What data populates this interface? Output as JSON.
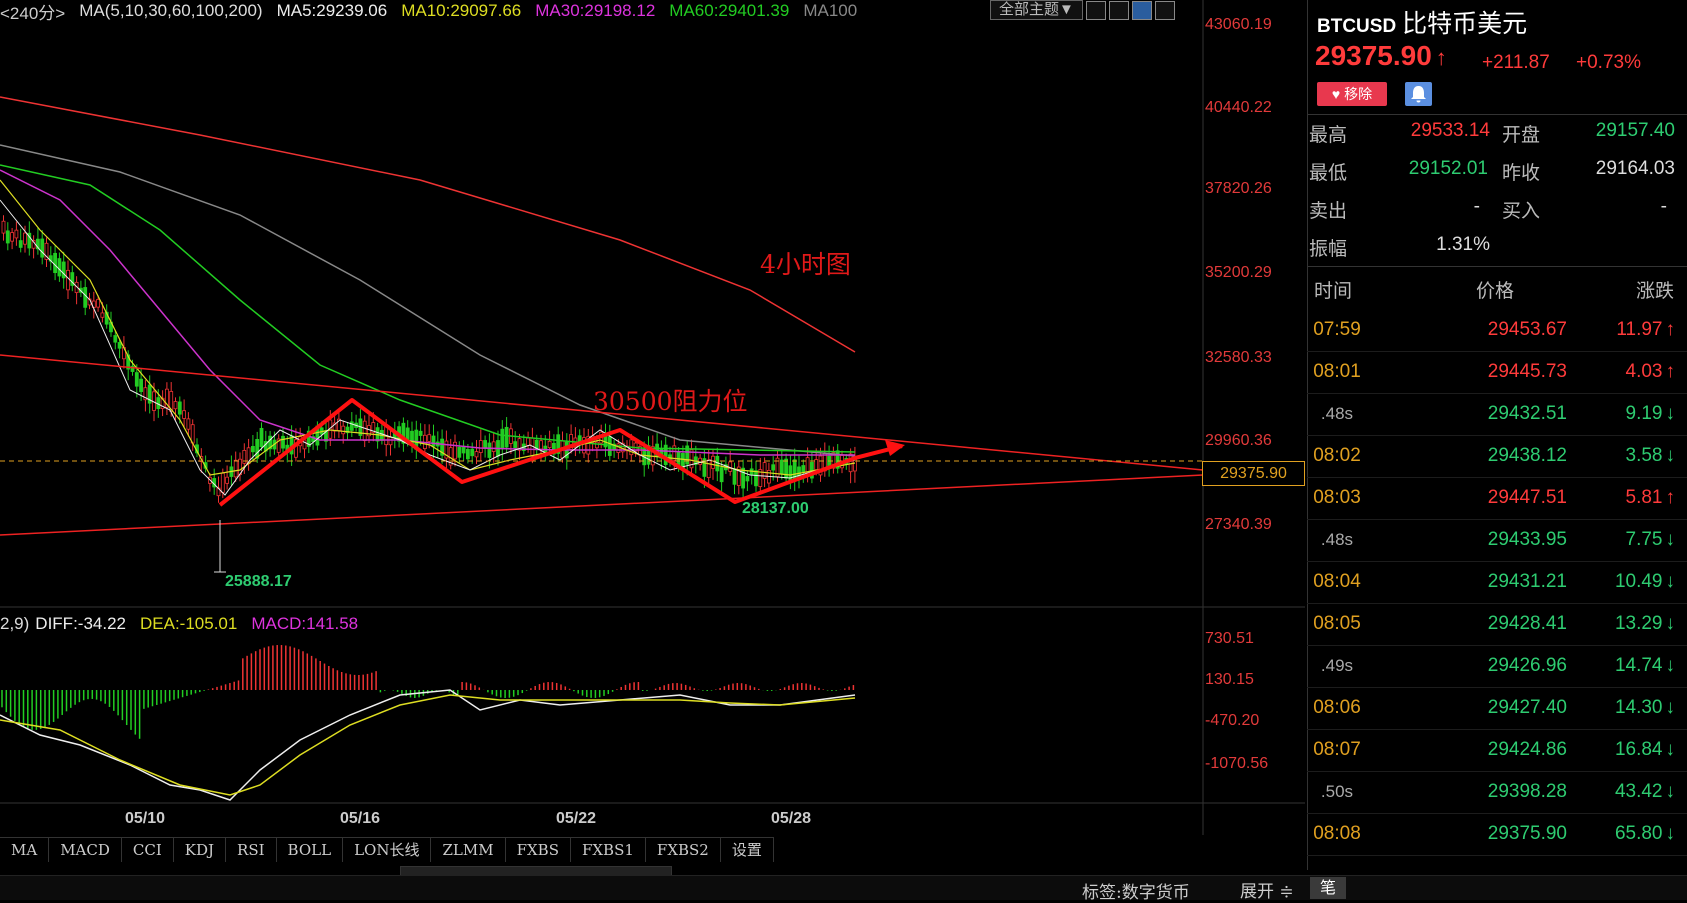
{
  "legend": {
    "period": "<240分>",
    "ma_def": "MA(5,10,30,60,100,200)",
    "ma5": "MA5:29239.06",
    "ma10": "MA10:29097.66",
    "ma30": "MA30:29198.12",
    "ma60": "MA60:29401.39",
    "ma100": "MA100",
    "theme_button": "全部主题▼"
  },
  "price_axis": [
    "43060.19",
    "40440.22",
    "37820.26",
    "35200.29",
    "32580.33",
    "29960.36",
    "27340.39"
  ],
  "current_price_tag": "29375.90",
  "annotations": {
    "timeframe": "4小时图",
    "resistance": "30500阻力位",
    "low1": "28137.00",
    "low2": "25888.17"
  },
  "macd": {
    "params": "2,9)",
    "diff": "DIFF:-34.22",
    "dea": "DEA:-105.01",
    "macd": "MACD:141.58",
    "axis": [
      "730.51",
      "130.15",
      "-470.20",
      "-1070.56"
    ]
  },
  "dates": [
    "05/10",
    "05/16",
    "05/22",
    "05/28"
  ],
  "tabs": [
    "MA",
    "MACD",
    "CCI",
    "KDJ",
    "RSI",
    "BOLL",
    "LON长线",
    "ZLMM",
    "FXBS",
    "FXBS1",
    "FXBS2",
    "设置"
  ],
  "bottom": {
    "tag": "标签:数字货币",
    "expand": "展开 ≑",
    "pen": "笔"
  },
  "side": {
    "code": "BTCUSD",
    "name": "比特币美元",
    "price": "29375.90",
    "arrow": "↑",
    "change": "+211.87",
    "change_pct": "+0.73%",
    "remove_btn": "移除",
    "quote": {
      "high_label": "最高",
      "high": "29533.14",
      "open_label": "开盘",
      "open": "29157.40",
      "low_label": "最低",
      "low": "29152.01",
      "prev_label": "昨收",
      "prev": "29164.03",
      "ask_label": "卖出",
      "ask": "-",
      "bid_label": "买入",
      "bid": "-",
      "amp_label": "振幅",
      "amp": "1.31%"
    },
    "tick_headers": [
      "时间",
      "价格",
      "涨跌"
    ],
    "ticks": [
      {
        "time": "07:59",
        "price": "29453.67",
        "chg": "11.97",
        "dir": "up",
        "sec": false
      },
      {
        "time": "08:01",
        "price": "29445.73",
        "chg": "4.03",
        "dir": "up",
        "sec": false
      },
      {
        "time": ".48s",
        "price": "29432.51",
        "chg": "9.19",
        "dir": "down",
        "sec": true
      },
      {
        "time": "08:02",
        "price": "29438.12",
        "chg": "3.58",
        "dir": "down",
        "sec": false
      },
      {
        "time": "08:03",
        "price": "29447.51",
        "chg": "5.81",
        "dir": "up",
        "sec": false
      },
      {
        "time": ".48s",
        "price": "29433.95",
        "chg": "7.75",
        "dir": "down",
        "sec": true
      },
      {
        "time": "08:04",
        "price": "29431.21",
        "chg": "10.49",
        "dir": "down",
        "sec": false
      },
      {
        "time": "08:05",
        "price": "29428.41",
        "chg": "13.29",
        "dir": "down",
        "sec": false
      },
      {
        "time": ".49s",
        "price": "29426.96",
        "chg": "14.74",
        "dir": "down",
        "sec": true
      },
      {
        "time": "08:06",
        "price": "29427.40",
        "chg": "14.30",
        "dir": "down",
        "sec": false
      },
      {
        "time": "08:07",
        "price": "29424.86",
        "chg": "16.84",
        "dir": "down",
        "sec": false
      },
      {
        "time": ".50s",
        "price": "29398.28",
        "chg": "43.42",
        "dir": "down",
        "sec": true
      },
      {
        "time": "08:08",
        "price": "29375.90",
        "chg": "65.80",
        "dir": "down",
        "sec": false
      }
    ],
    "colors": {
      "up": "#ff3b3b",
      "down": "#2ecc71"
    }
  }
}
